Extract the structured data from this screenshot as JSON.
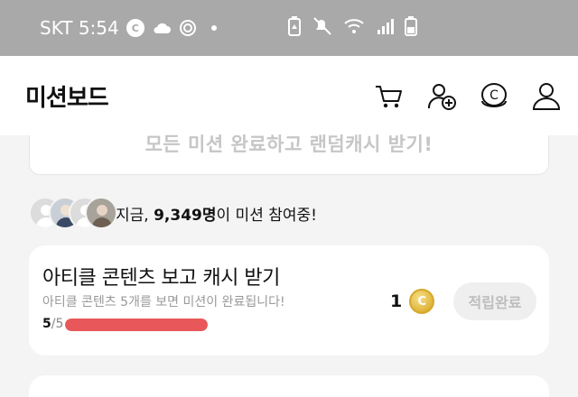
{
  "status_bar": {
    "carrier_time": "SKT 5:54",
    "circle_c_icon": "c-circle-icon",
    "icons": [
      "cloud-icon",
      "settings-ring-icon",
      "recycle-battery-icon",
      "mute-icon",
      "wifi-icon",
      "signal-icon",
      "battery-icon"
    ]
  },
  "header": {
    "title": "미션보드",
    "icons": [
      "cart-icon",
      "add-user-icon",
      "cash-icon",
      "profile-icon"
    ]
  },
  "banner": {
    "text": "모든 미션 완료하고 랜덤캐시 받기!"
  },
  "participants": {
    "prefix": "지금, ",
    "count": "9,349명",
    "suffix": "이 미션 참여중!"
  },
  "mission": {
    "title": "아티클 콘텐츠 보고 캐시 받기",
    "description": "아티클 콘텐츠 5개를 보면 미션이 완료됩니다!",
    "progress_done": "5",
    "progress_total": "/5",
    "progress_fraction": 1.0,
    "reward_amount": "1",
    "coin_symbol": "C",
    "button_label": "적립완료"
  },
  "colors": {
    "status_bar": "#a9a9a9",
    "progress": "#e8585a",
    "coin": "#e0b53a"
  }
}
